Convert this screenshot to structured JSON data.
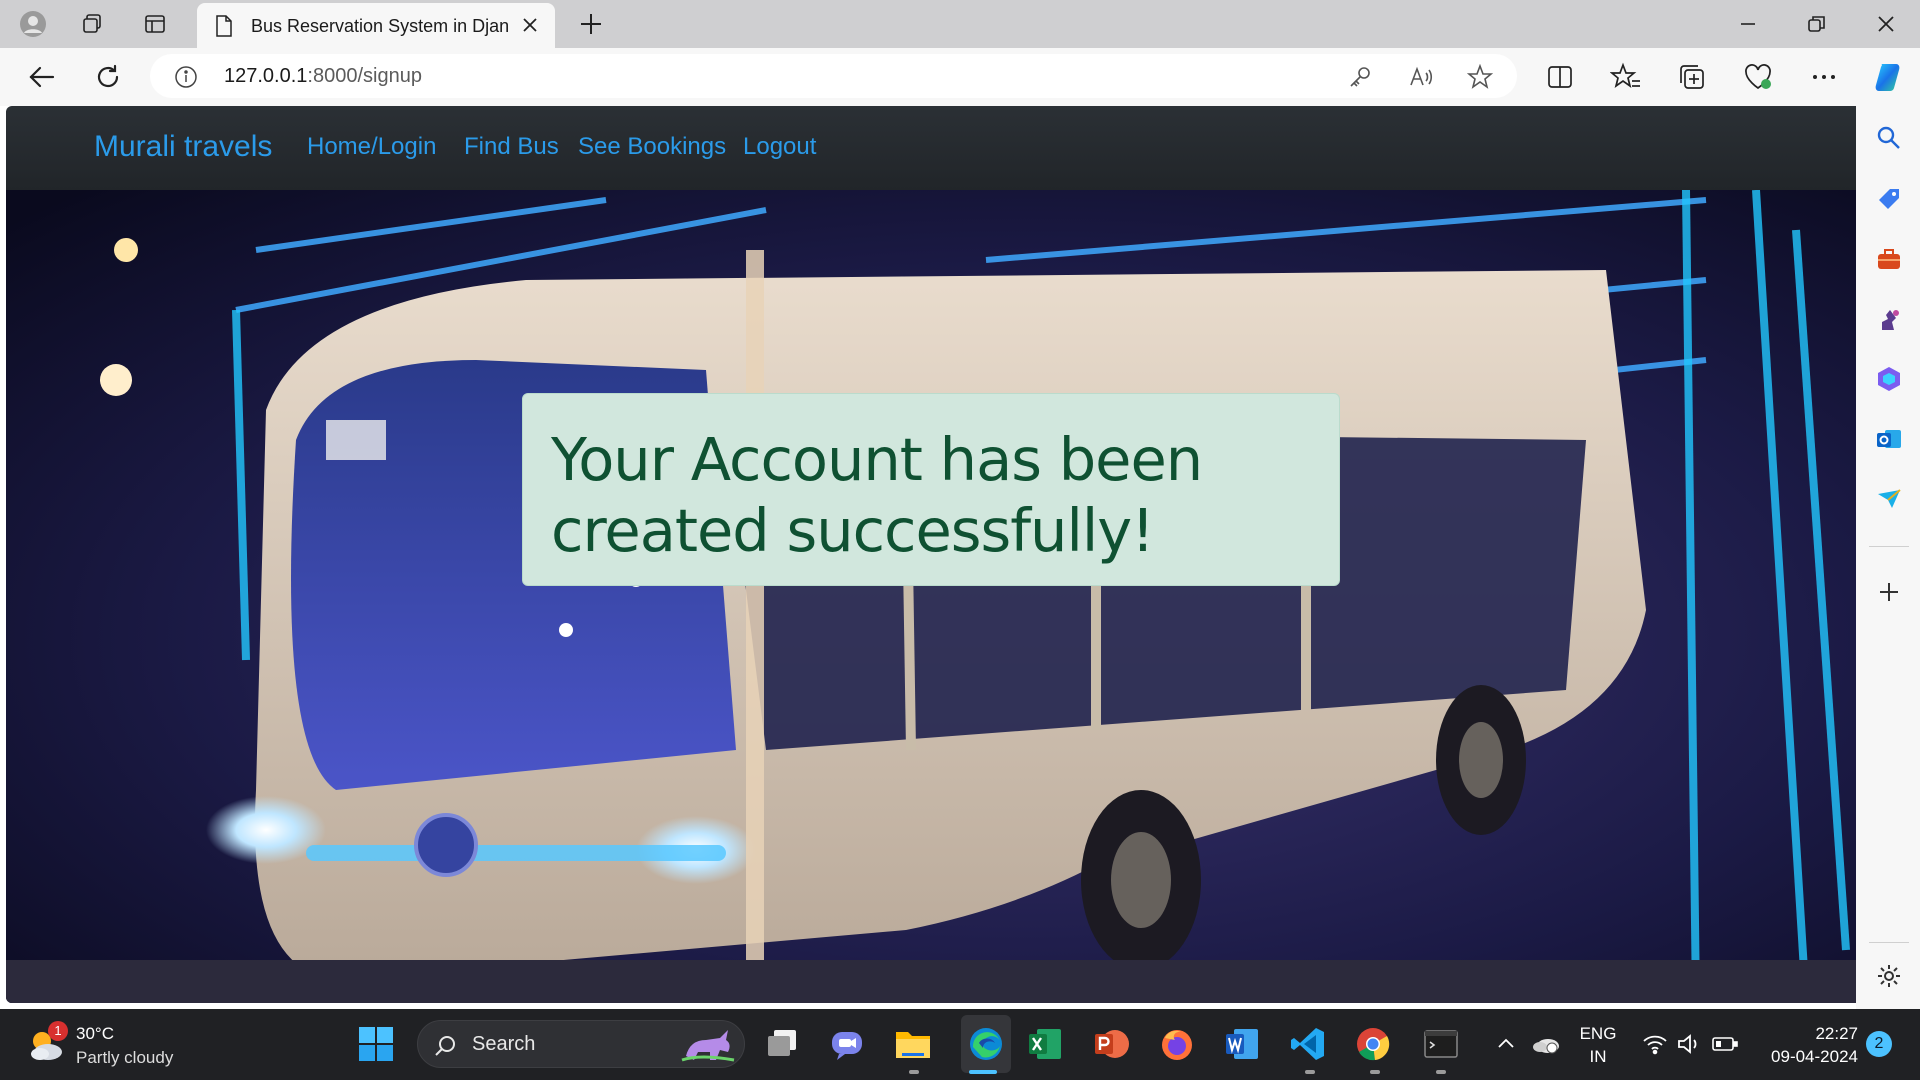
{
  "browser": {
    "tab_title": "Bus Reservation System in Django",
    "url_host": "127.0.0.1",
    "url_rest": ":8000/signup",
    "icons": [
      "profile-icon",
      "workspaces-icon",
      "vertical-tabs-icon",
      "document-icon",
      "close-icon",
      "new-tab-icon",
      "minimize-icon",
      "restore-icon",
      "close-window-icon",
      "back-icon",
      "refresh-icon",
      "info-icon",
      "key-icon",
      "read-aloud-icon",
      "favorite-star-icon",
      "split-screen-icon",
      "favorites-icon",
      "collections-icon",
      "browser-essentials-icon",
      "more-icon",
      "copilot-icon"
    ]
  },
  "sidebar": {
    "icons": [
      "search-icon",
      "shopping-tag-icon",
      "tools-icon",
      "games-icon",
      "office-icon",
      "outlook-icon",
      "drop-icon",
      "add-icon",
      "settings-icon"
    ]
  },
  "page": {
    "brand": "Murali travels",
    "nav": [
      {
        "label": "Home/Login"
      },
      {
        "label": "Find Bus"
      },
      {
        "label": "See Bookings"
      },
      {
        "label": "Logout"
      }
    ],
    "alert_message": "Your Account has been created successfully!",
    "colors": {
      "navbar": "#212529",
      "link": "#2b9bea",
      "alert_bg": "#d1e7dd",
      "alert_text": "#0f5132"
    }
  },
  "taskbar": {
    "weather_temp": "30°C",
    "weather_desc": "Partly cloudy",
    "weather_badge": "1",
    "search_label": "Search",
    "apps": [
      "task-view",
      "meet",
      "file-explorer",
      "edge",
      "excel",
      "powerpoint",
      "firefox",
      "word",
      "vscode",
      "chrome",
      "terminal"
    ],
    "lang_1": "ENG",
    "lang_2": "IN",
    "time": "22:27",
    "date": "09-04-2024",
    "notifications": "2"
  }
}
